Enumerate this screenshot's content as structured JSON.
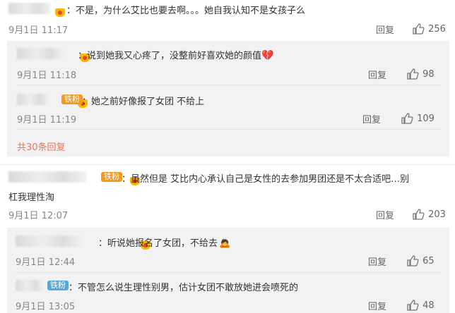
{
  "comments": [
    {
      "text": "：不是，为什么艾比也要去啊。。。她自我认知不是女孩子么",
      "time": "9月1日 11:17",
      "reply": "回复",
      "likes": "256",
      "replies": [
        {
          "text": "：说到她我又心疼了，没整前好喜欢她的颜值",
          "time": "9月1日 11:18",
          "reply": "回复",
          "likes": "98"
        },
        {
          "badge": "铁粉",
          "text": "：她之前好像报了女团 不给上",
          "time": "9月1日 11:19",
          "reply": "回复",
          "likes": "109"
        }
      ],
      "more": "共30条回复"
    },
    {
      "badge": "铁粉",
      "text_line1": "：虽然但是 艾比内心承认自己是女性的去参加男团还是不太合适吧…别",
      "text_line2": "杠我理性淘",
      "time": "9月1日 12:07",
      "reply": "回复",
      "likes": "203",
      "replies": [
        {
          "text": "：听说她报名了女团，不给去",
          "time": "9月1日 12:44",
          "reply": "回复",
          "likes": "65"
        },
        {
          "badge": "铁粉",
          "text": "：不管怎么说生理性别男，估计女团不敢放她进会喷死的",
          "time": "9月1日 13:05",
          "reply": "回复",
          "likes": "48"
        }
      ]
    }
  ],
  "icons": {
    "like": "thumbs-up-icon",
    "heart": "broken-heart-icon",
    "emoji": "person-emoji-icon",
    "crown": "vip-crown-icon"
  },
  "colors": {
    "more_link": "#eb7350",
    "badge_orange": "#f29a1b",
    "badge_blue": "#57a8d8",
    "sub_bg": "#f2f2f5"
  }
}
